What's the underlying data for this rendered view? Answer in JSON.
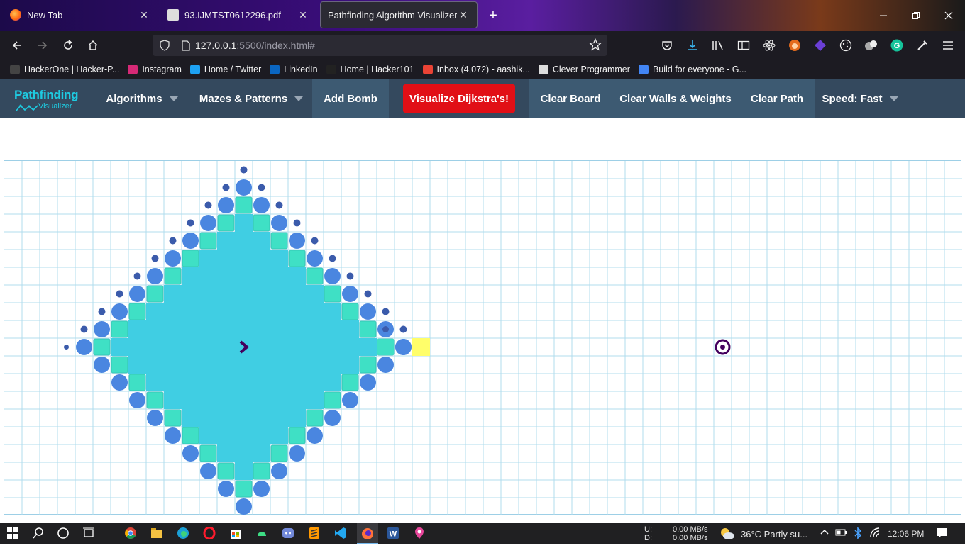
{
  "browser": {
    "tabs": [
      {
        "title": "New Tab",
        "active": false
      },
      {
        "title": "93.IJMTST0612296.pdf",
        "active": false
      },
      {
        "title": "Pathfinding Algorithm Visualizer",
        "active": true
      }
    ],
    "new_tab_label": "+",
    "url_host": "127.0.0.1",
    "url_rest": ":5500/index.html#",
    "bookmarks": [
      {
        "label": "HackerOne | Hacker-P...",
        "icon": "hackerone-icon",
        "color": "#444444"
      },
      {
        "label": "Instagram",
        "icon": "instagram-icon",
        "color": "#d62976"
      },
      {
        "label": "Home / Twitter",
        "icon": "twitter-icon",
        "color": "#1da1f2"
      },
      {
        "label": "LinkedIn",
        "icon": "linkedin-icon",
        "color": "#0a66c2"
      },
      {
        "label": "Home | Hacker101",
        "icon": "hacker101-icon",
        "color": "#222222"
      },
      {
        "label": "Inbox (4,072) - aashik...",
        "icon": "gmail-icon",
        "color": "#ea4335"
      },
      {
        "label": "Clever Programmer",
        "icon": "github-icon",
        "color": "#dddddd"
      },
      {
        "label": "Build for everyone - G...",
        "icon": "google-icon",
        "color": "#4285f4"
      }
    ]
  },
  "app": {
    "logo_line1": "Pathfinding",
    "logo_line2": "Visualizer",
    "nav": {
      "algorithms": "Algorithms",
      "mazes": "Mazes & Patterns",
      "add_bomb": "Add Bomb",
      "visualize": "Visualize Dijkstra's!",
      "clear_board": "Clear Board",
      "clear_walls": "Clear Walls & Weights",
      "clear_path": "Clear Path",
      "speed": "Speed: Fast"
    },
    "colors": {
      "nav_bg": "#34495e",
      "visualize_btn": "#e10f16",
      "visited": "#40cee3",
      "visited_edge": "#3fe0c5",
      "frontier": "#4a86e0",
      "path": "#fffe6a",
      "grid_line": "#b0dcee",
      "target": "#44005e"
    }
  },
  "grid": {
    "start": {
      "row": 10,
      "col": 13
    },
    "target": {
      "row": 10,
      "col": 40
    },
    "shortest_path_cell": {
      "row": 10,
      "col": 23
    }
  },
  "taskbar": {
    "net_upload_label": "U:",
    "net_download_label": "D:",
    "net_upload": "0.00 MB/s",
    "net_download": "0.00 MB/s",
    "weather": "36°C  Partly su...",
    "time": "12:06 PM"
  }
}
